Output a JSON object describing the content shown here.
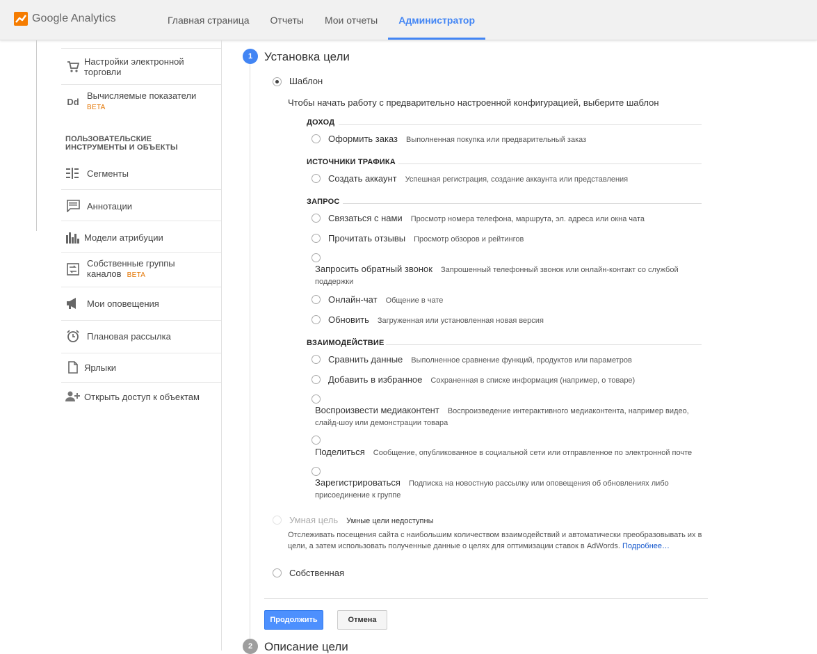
{
  "app": {
    "brand": "Google Analytics"
  },
  "nav": {
    "tabs": [
      "Главная страница",
      "Отчеты",
      "Мои отчеты",
      "Администратор"
    ],
    "active_index": 3
  },
  "sidebar": {
    "top_items": [
      {
        "label": "Настройки электронной торговли",
        "icon": "cart-icon"
      },
      {
        "label": "Вычисляемые показатели",
        "badge": "BETA",
        "icon": "dd-icon"
      }
    ],
    "section_heading": "ПОЛЬЗОВАТЕЛЬСКИЕ ИНСТРУМЕНТЫ И ОБЪЕКТЫ",
    "items": [
      {
        "label": "Сегменты",
        "icon": "segments-icon"
      },
      {
        "label": "Аннотации",
        "icon": "annotation-icon"
      },
      {
        "label": "Модели атрибуции",
        "icon": "bar-chart-icon"
      },
      {
        "label": "Собственные группы каналов",
        "badge": "BETA",
        "icon": "channel-groups-icon"
      },
      {
        "label": "Мои оповещения",
        "icon": "megaphone-icon"
      },
      {
        "label": "Плановая рассылка",
        "icon": "alarm-clock-icon"
      },
      {
        "label": "Ярлыки",
        "icon": "document-icon"
      },
      {
        "label": "Открыть доступ к объектам",
        "icon": "add-person-icon"
      }
    ]
  },
  "step1": {
    "number": "1",
    "title": "Установка цели",
    "template_label": "Шаблон",
    "template_hint": "Чтобы начать работу с предварительно настроенной конфигурацией, выберите шаблон",
    "categories": [
      {
        "name": "ДОХОД",
        "options": [
          {
            "title": "Оформить заказ",
            "desc": "Выполненная покупка или предварительный заказ"
          }
        ]
      },
      {
        "name": "ИСТОЧНИКИ ТРАФИКА",
        "options": [
          {
            "title": "Создать аккаунт",
            "desc": "Успешная регистрация, создание аккаунта или представления"
          }
        ]
      },
      {
        "name": "ЗАПРОС",
        "options": [
          {
            "title": "Связаться с нами",
            "desc": "Просмотр номера телефона, маршрута, эл. адреса или окна чата"
          },
          {
            "title": "Прочитать отзывы",
            "desc": "Просмотр обзоров и рейтингов"
          },
          {
            "title": "Запросить обратный звонок",
            "desc": "Запрошенный телефонный звонок или онлайн-контакт со службой поддержки"
          },
          {
            "title": "Онлайн-чат",
            "desc": "Общение в чате"
          },
          {
            "title": "Обновить",
            "desc": "Загруженная или установленная новая версия"
          }
        ]
      },
      {
        "name": "ВЗАИМОДЕЙСТВИЕ",
        "options": [
          {
            "title": "Сравнить данные",
            "desc": "Выполненное сравнение функций, продуктов или параметров"
          },
          {
            "title": "Добавить в избранное",
            "desc": "Сохраненная в списке информация (например, о товаре)"
          },
          {
            "title": "Воспроизвести медиаконтент",
            "desc": "Воспроизведение интерактивного медиаконтента, например видео, слайд-шоу или демонстрации товара"
          },
          {
            "title": "Поделиться",
            "desc": "Сообщение, опубликованное в социальной сети или отправленное по электронной почте"
          },
          {
            "title": "Зарегистрироваться",
            "desc": "Подписка на новостную рассылку или оповещения об обновлениях либо присоединение к группе"
          }
        ]
      }
    ],
    "smart_goal": {
      "label": "Умная цель",
      "status": "Умные цели недоступны",
      "desc": "Отслеживать посещения сайта с наибольшим количеством взаимодействий и автоматически преобразовывать их в цели, а затем использовать полученные данные о целях для оптимизации ставок в AdWords.",
      "link": "Подробнее…"
    },
    "custom_label": "Собственная",
    "continue_button": "Продолжить",
    "cancel_button": "Отмена"
  },
  "step2": {
    "number": "2",
    "title": "Описание цели"
  },
  "colors": {
    "accent": "#4285f4",
    "primary_button": "#4d90fe",
    "beta": "#e37400",
    "step_active": "#4285f4",
    "step_inactive": "#9e9e9e"
  }
}
